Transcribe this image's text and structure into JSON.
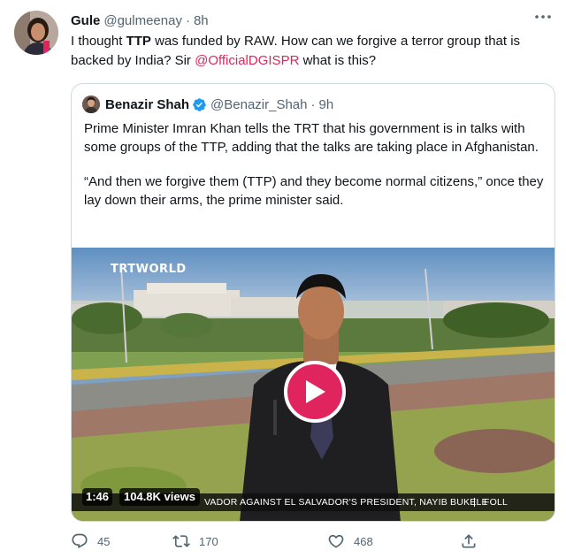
{
  "tweet": {
    "author": {
      "name": "Gule",
      "handle": "@gulmeenay",
      "separator": "·",
      "time": "8h"
    },
    "more_icon": "more-horizontal-icon",
    "text": {
      "part1": "I thought ",
      "bold": "TTP",
      "part2": " was funded by RAW. How can we forgive a terror group that is backed by India? Sir ",
      "mention": "@OfficialDGISPR",
      "part3": " what is this?"
    },
    "colors": {
      "mention": "#e0245e",
      "verified": "#1d9bf0",
      "play": "#e0245e"
    }
  },
  "quote": {
    "author": {
      "name": "Benazir Shah",
      "handle": "@Benazir_Shah",
      "separator": "·",
      "time": "9h"
    },
    "paragraph1": "Prime Minister Imran Khan tells the TRT that his government is in talks with some groups of the TTP, adding that the talks are taking place in Afghanistan.",
    "paragraph2": "“And then we forgive them (TTP) and they become normal citizens,” once they lay down their arms, the prime minister said.",
    "video": {
      "logo": "TRTWORLD",
      "duration": "1:46",
      "views": "104.8K views",
      "ticker": "VADOR AGAINST EL SALVADOR'S PRESIDENT, NAYIB BUKELE",
      "ticker_end": "FOLL"
    }
  },
  "actions": {
    "reply": {
      "icon": "reply-icon",
      "count": "45"
    },
    "retweet": {
      "icon": "retweet-icon",
      "count": "170"
    },
    "like": {
      "icon": "like-icon",
      "count": "468"
    },
    "share": {
      "icon": "share-icon"
    }
  }
}
